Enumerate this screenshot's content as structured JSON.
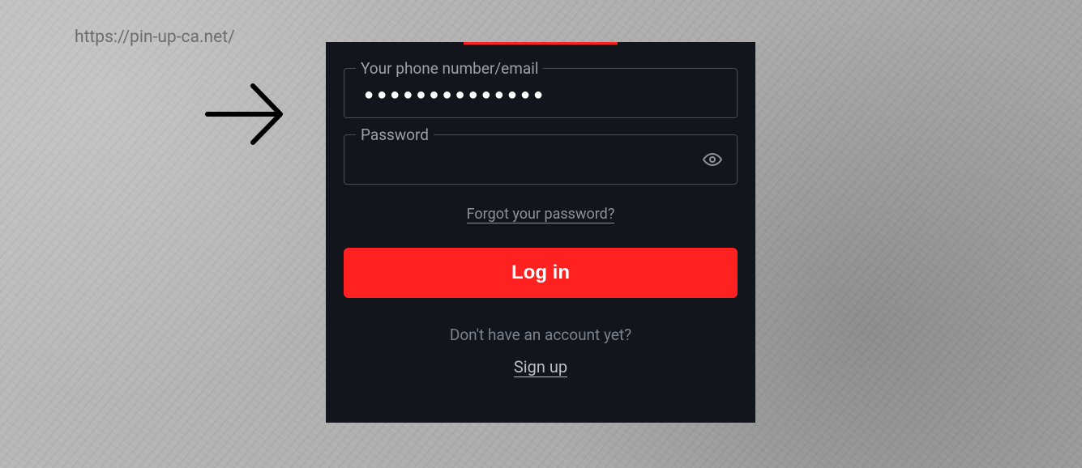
{
  "url": "https://pin-up-ca.net/",
  "login": {
    "phone_email_label": "Your phone number/email",
    "phone_email_value_masked": "●●●●●●●●●●●●●●",
    "password_label": "Password",
    "password_value": "",
    "forgot_password": "Forgot your password?",
    "login_button": "Log in",
    "no_account": "Don't have an account yet?",
    "signup": "Sign up"
  },
  "colors": {
    "accent": "#ff2020",
    "panel_bg": "#12151C"
  }
}
